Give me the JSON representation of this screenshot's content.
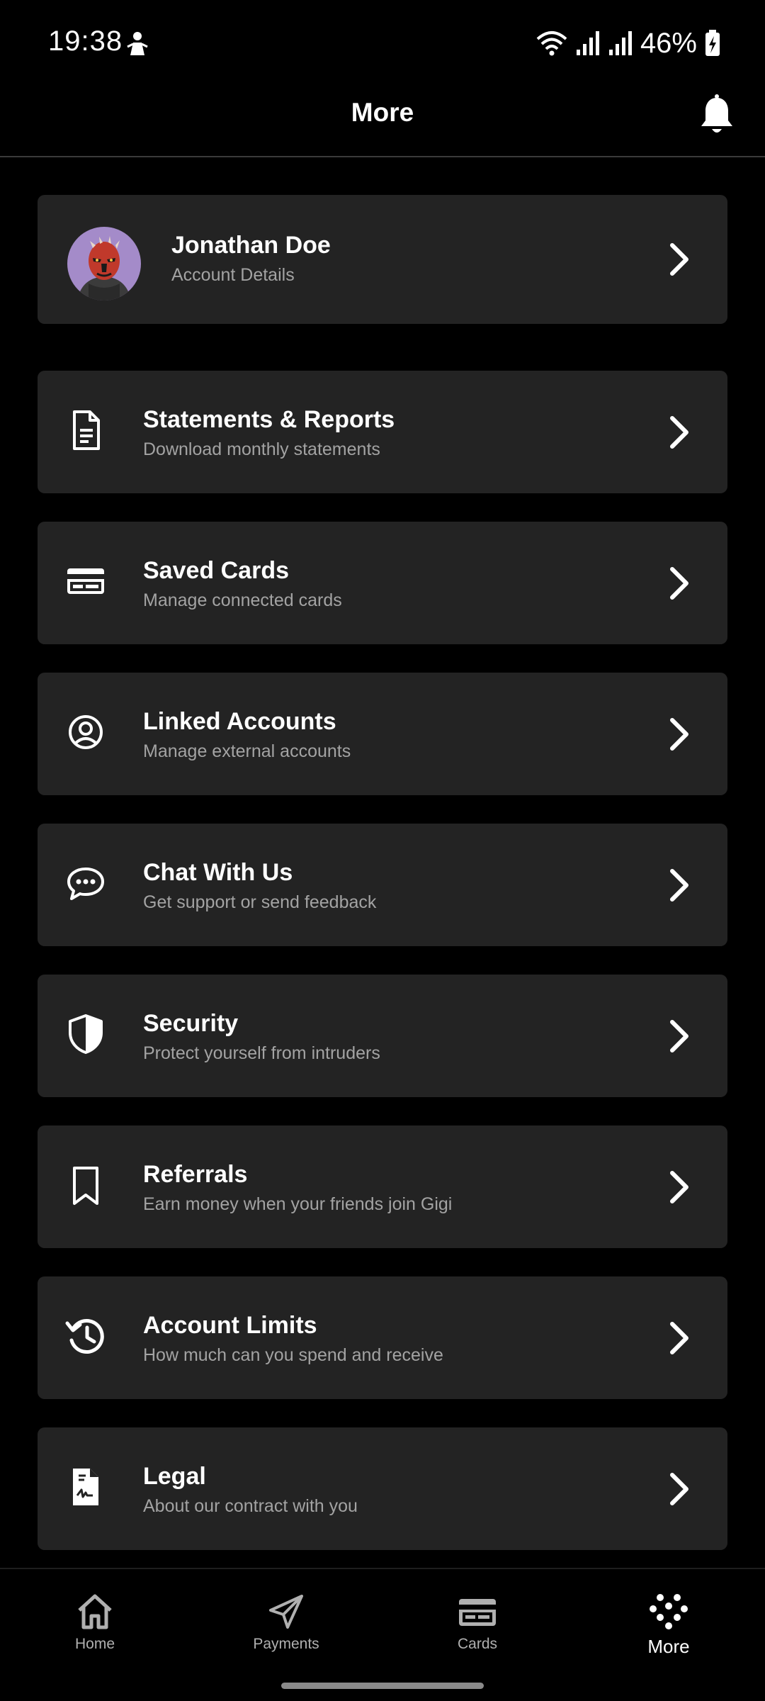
{
  "status_bar": {
    "time": "19:38",
    "battery": "46%"
  },
  "header": {
    "title": "More",
    "bell_icon": "bell-icon"
  },
  "profile": {
    "name": "Jonathan Doe",
    "subtitle": "Account Details"
  },
  "menu": [
    {
      "title": "Statements & Reports",
      "subtitle": "Download monthly statements",
      "icon": "document-icon"
    },
    {
      "title": "Saved Cards",
      "subtitle": "Manage connected cards",
      "icon": "credit-card-icon"
    },
    {
      "title": "Linked Accounts",
      "subtitle": "Manage external accounts",
      "icon": "user-circle-icon"
    },
    {
      "title": "Chat With Us",
      "subtitle": "Get support or send feedback",
      "icon": "chat-icon"
    },
    {
      "title": "Security",
      "subtitle": "Protect yourself from intruders",
      "icon": "shield-icon"
    },
    {
      "title": "Referrals",
      "subtitle": "Earn money when your friends join Gigi",
      "icon": "bookmark-icon"
    },
    {
      "title": "Account Limits",
      "subtitle": "How much can you spend and receive",
      "icon": "history-icon"
    },
    {
      "title": "Legal",
      "subtitle": "About our contract with you",
      "icon": "contract-icon"
    }
  ],
  "bottom_nav": [
    {
      "label": "Home",
      "icon": "home-icon",
      "active": false
    },
    {
      "label": "Payments",
      "icon": "paper-plane-icon",
      "active": false
    },
    {
      "label": "Cards",
      "icon": "card-icon",
      "active": false
    },
    {
      "label": "More",
      "icon": "dots-grid-icon",
      "active": true
    }
  ],
  "colors": {
    "background": "#000000",
    "card": "#232323",
    "subtitle": "#a3a3a3",
    "accent": "#ffffff"
  }
}
